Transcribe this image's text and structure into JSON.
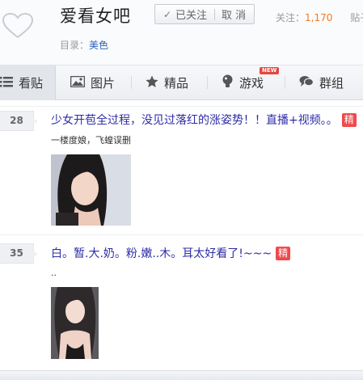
{
  "header": {
    "forum_title": "爱看女吧",
    "follow_label": "已关注",
    "cancel_label": "取 消",
    "followers_label": "关注：",
    "followers_count": "1,170",
    "posts_label": "贴子",
    "catalog_label": "目录：",
    "catalog_value": "美色"
  },
  "nav": {
    "tabs": [
      {
        "label": "看贴",
        "icon": "post-list-icon",
        "active": true
      },
      {
        "label": "图片",
        "icon": "picture-icon"
      },
      {
        "label": "精品",
        "icon": "star-icon"
      },
      {
        "label": "游戏",
        "icon": "game-icon",
        "badge": "NEW"
      },
      {
        "label": "群组",
        "icon": "group-chat-icon"
      }
    ]
  },
  "threads": [
    {
      "reply_count": "28",
      "title": "少女开苞全过程，没见过落红的涨姿势！！直播+视频。。",
      "badge": "精",
      "abstract": "一楼度娘，飞蝗误删"
    },
    {
      "reply_count": "35",
      "title": "白。暂.大.奶。粉.嫩..木。耳太好看了!~~~",
      "badge": "精",
      "abstract": ".."
    }
  ],
  "colors": {
    "link": "#2d2da8",
    "count": "#f47920",
    "badge": "#f0494c"
  }
}
